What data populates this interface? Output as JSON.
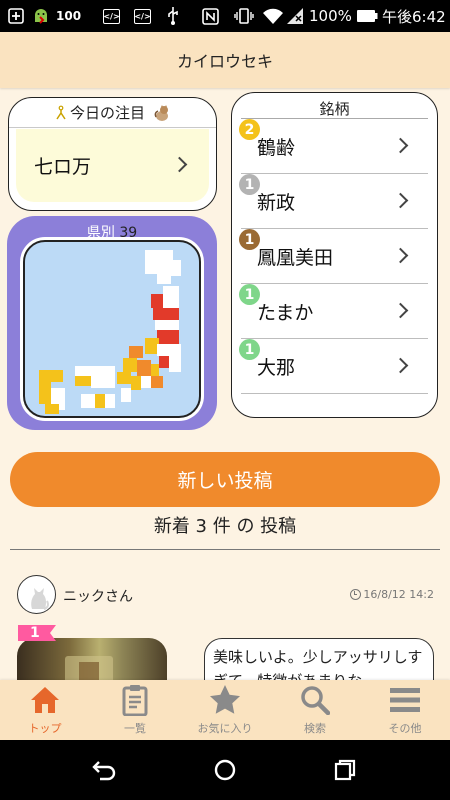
{
  "status_bar": {
    "notification_count": "100",
    "battery_percent": "100%",
    "time": "午後6:42",
    "icons": [
      "add-icon",
      "android-debug-icon",
      "code-icon",
      "code-icon",
      "usb-icon",
      "nfc-icon",
      "vibrate-icon",
      "wifi-icon",
      "signal-icon",
      "battery-icon"
    ]
  },
  "header": {
    "title": "カイロウセキ"
  },
  "featured": {
    "title": "今日の注目",
    "item": "七ロ万"
  },
  "prefecture": {
    "label": "県別",
    "count": "39"
  },
  "brands": {
    "title": "銘柄",
    "items": [
      {
        "rank": "2",
        "name": "鶴齢",
        "badge_color": "#f4c21b"
      },
      {
        "rank": "1",
        "name": "新政",
        "badge_color": "#b3b3b3"
      },
      {
        "rank": "1",
        "name": "鳳凰美田",
        "badge_color": "#9a6a33"
      },
      {
        "rank": "1",
        "name": "たまか",
        "badge_color": "#7fd68a"
      },
      {
        "rank": "1",
        "name": "大那",
        "badge_color": "#7fd68a"
      }
    ]
  },
  "new_post_button": "新しい投稿",
  "new_posts": "新着 3 件 の 投稿",
  "post": {
    "user": "ニックさん",
    "time": "16/8/12 14:2",
    "rank": "1",
    "text": "美味しいよ。少しアッサリしすぎて、特徴があまりな"
  },
  "bottom_nav": [
    {
      "label": "トップ",
      "icon": "home-icon",
      "active": true
    },
    {
      "label": "一覧",
      "icon": "clipboard-icon",
      "active": false
    },
    {
      "label": "お気に入り",
      "icon": "star-icon",
      "active": false
    },
    {
      "label": "検索",
      "icon": "search-icon",
      "active": false
    },
    {
      "label": "その他",
      "icon": "menu-icon",
      "active": false
    }
  ],
  "colors": {
    "accent_orange": "#f08a2c",
    "header_bg": "#fae3c0",
    "page_bg": "#fdf3e3",
    "map_card_bg": "#8c7fd9",
    "nav_active": "#e6672b"
  }
}
